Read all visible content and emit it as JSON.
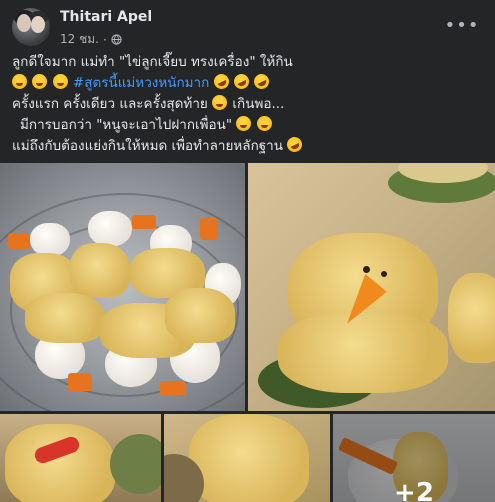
{
  "post": {
    "author": "Thitari Apel",
    "time": "12 ชม.",
    "separator": "·",
    "more_label": "•••",
    "text_lines": [
      "ลูกดีใจมาก แม่ทำ \"ไข่ลูกเจี๊ยบ ทรงเครื่อง\" ให้กิน",
      "#สูตรนี้แม่หวงหนักมาก",
      "ครั้งแรก  ครั้งเดียว และครั้งสุดท้าย",
      "เกินพอ...",
      "มีการบอกว่า \"หนูจะเอาไปฝากเพื่อน\"",
      "แม่ถึงกับต้องแย่งกินให้หมด เพื่อทำลายหลักฐาน"
    ]
  },
  "gallery": {
    "more_count": "+2"
  },
  "icons": {
    "globe": "globe-icon",
    "more": "more-options-icon",
    "emoji_grin": "grinning-squinting-face",
    "emoji_rofl": "rolling-on-floor-laughing"
  },
  "colors": {
    "background": "#242526",
    "text": "#e4e6eb",
    "secondary": "#b0b3b8",
    "hashtag": "#4599ff"
  }
}
